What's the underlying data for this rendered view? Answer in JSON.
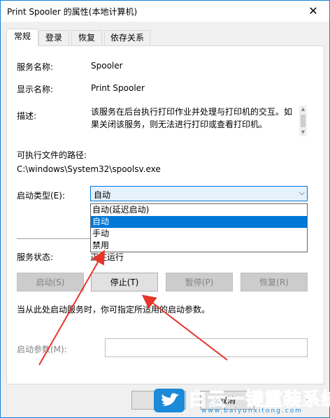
{
  "window": {
    "title": "Print Spooler 的属性(本地计算机)",
    "close_glyph": "✕"
  },
  "tabs": [
    {
      "label": "常规"
    },
    {
      "label": "登录"
    },
    {
      "label": "恢复"
    },
    {
      "label": "依存关系"
    }
  ],
  "general": {
    "service_name_label": "服务名称:",
    "service_name": "Spooler",
    "display_name_label": "显示名称:",
    "display_name": "Print Spooler",
    "description_label": "描述:",
    "description": "该服务在后台执行打印作业并处理与打印机的交互。如果关闭该服务，则无法进行打印或查看打印机。",
    "exe_path_label": "可执行文件的路径:",
    "exe_path": "C:\\windows\\System32\\spoolsv.exe",
    "startup_type_label": "启动类型(E):",
    "startup_type_value": "自动",
    "startup_options": [
      "自动(延迟启动)",
      "自动",
      "手动",
      "禁用"
    ],
    "service_status_label": "服务状态:",
    "service_status": "正在运行",
    "buttons": {
      "start": "启动(S)",
      "stop": "停止(T)",
      "pause": "暂停(P)",
      "resume": "恢复(R)"
    },
    "hint": "当从此处启动服务时，你可指定所适用的启动参数。",
    "start_params_label": "启动参数(M):",
    "start_params_value": ""
  },
  "footer": {
    "cancel": "取消"
  },
  "watermark": {
    "title": "白云一键重装系统",
    "url": "www.baiyunxitong.com"
  },
  "colors": {
    "accent": "#0078d7",
    "annotation_arrow": "#e8342a",
    "watermark": "#1b8ad8"
  }
}
